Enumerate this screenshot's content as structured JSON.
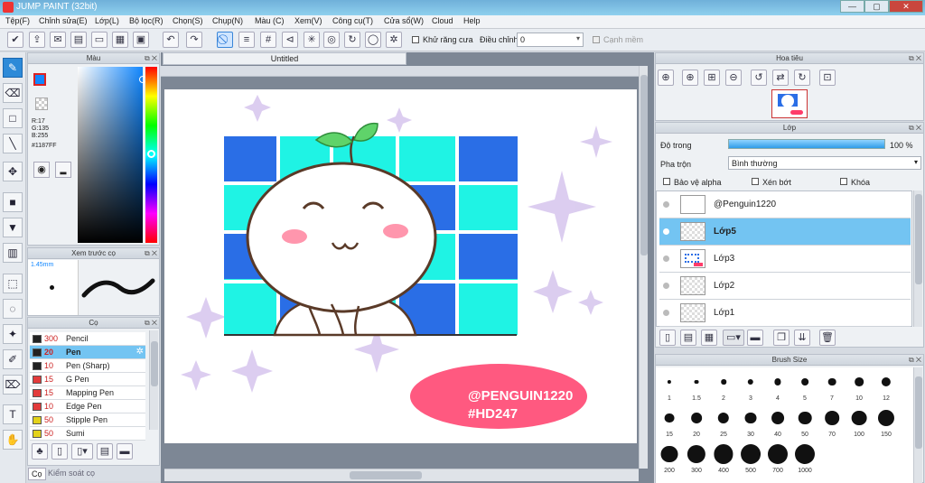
{
  "window": {
    "title": "JUMP PAINT (32bit)",
    "minimize": "—",
    "maximize": "▢",
    "close": "✕"
  },
  "menu": [
    "Tệp(F)",
    "Chỉnh sửa(E)",
    "Lớp(L)",
    "Bộ lọc(R)",
    "Chọn(S)",
    "Chụp(N)",
    "Màu (C)",
    "Xem(V)",
    "Công cụ(T)",
    "Cửa sổ(W)",
    "Cloud",
    "Help"
  ],
  "toolbar": {
    "antialias_label": "Khử răng cưa",
    "adjust_label": "Điều chỉnh",
    "adjust_value": "0",
    "snap_label": "Cạnh mềm"
  },
  "color_panel": {
    "title": "Màu",
    "r": "R:17",
    "g": "G:135",
    "b": "B:255",
    "hex": "#1187FF",
    "color": "#1187ff"
  },
  "preview_panel": {
    "title": "Xem trước cọ",
    "size": "1.45mm"
  },
  "brush_panel": {
    "title": "Cọ",
    "brushes": [
      {
        "size": "300",
        "name": "Pencil",
        "color": "#222222"
      },
      {
        "size": "20",
        "name": "Pen",
        "color": "#222222"
      },
      {
        "size": "10",
        "name": "Pen (Sharp)",
        "color": "#222222"
      },
      {
        "size": "15",
        "name": "G Pen",
        "color": "#e33b3b"
      },
      {
        "size": "15",
        "name": "Mapping Pen",
        "color": "#e33b3b"
      },
      {
        "size": "10",
        "name": "Edge Pen",
        "color": "#e33b3b"
      },
      {
        "size": "50",
        "name": "Stipple Pen",
        "color": "#e3d21b"
      },
      {
        "size": "50",
        "name": "Sumi",
        "color": "#e3d21b"
      }
    ],
    "footer_tab": "Cọ",
    "footer_tab2": "Kiểm soát cọ"
  },
  "document": {
    "tab": "Untitled"
  },
  "canvas_text": {
    "line1": "@PENGUIN1220",
    "line2": "#HD247"
  },
  "nav_panel": {
    "title": "Hoa tiêu"
  },
  "layer_panel": {
    "title": "Lớp",
    "opacity_label": "Độ trong",
    "opacity_value": "100 %",
    "opacity_fraction": 1.0,
    "blend_label": "Pha trộn",
    "blend_value": "Bình thường",
    "protect_alpha": "Bảo vệ alpha",
    "clipping": "Xén bớt",
    "lock": "Khóa",
    "layers": [
      {
        "name": "@Penguin1220"
      },
      {
        "name": "Lớp5"
      },
      {
        "name": "Lớp3"
      },
      {
        "name": "Lớp2"
      },
      {
        "name": "Lớp1"
      }
    ]
  },
  "brush_size_panel": {
    "title": "Brush Size",
    "sizes": [
      "1",
      "1.5",
      "2",
      "3",
      "4",
      "5",
      "7",
      "10",
      "12",
      "15",
      "20",
      "25",
      "30",
      "40",
      "50",
      "70",
      "100",
      "150",
      "200",
      "300",
      "400",
      "500",
      "700",
      "1000"
    ]
  }
}
